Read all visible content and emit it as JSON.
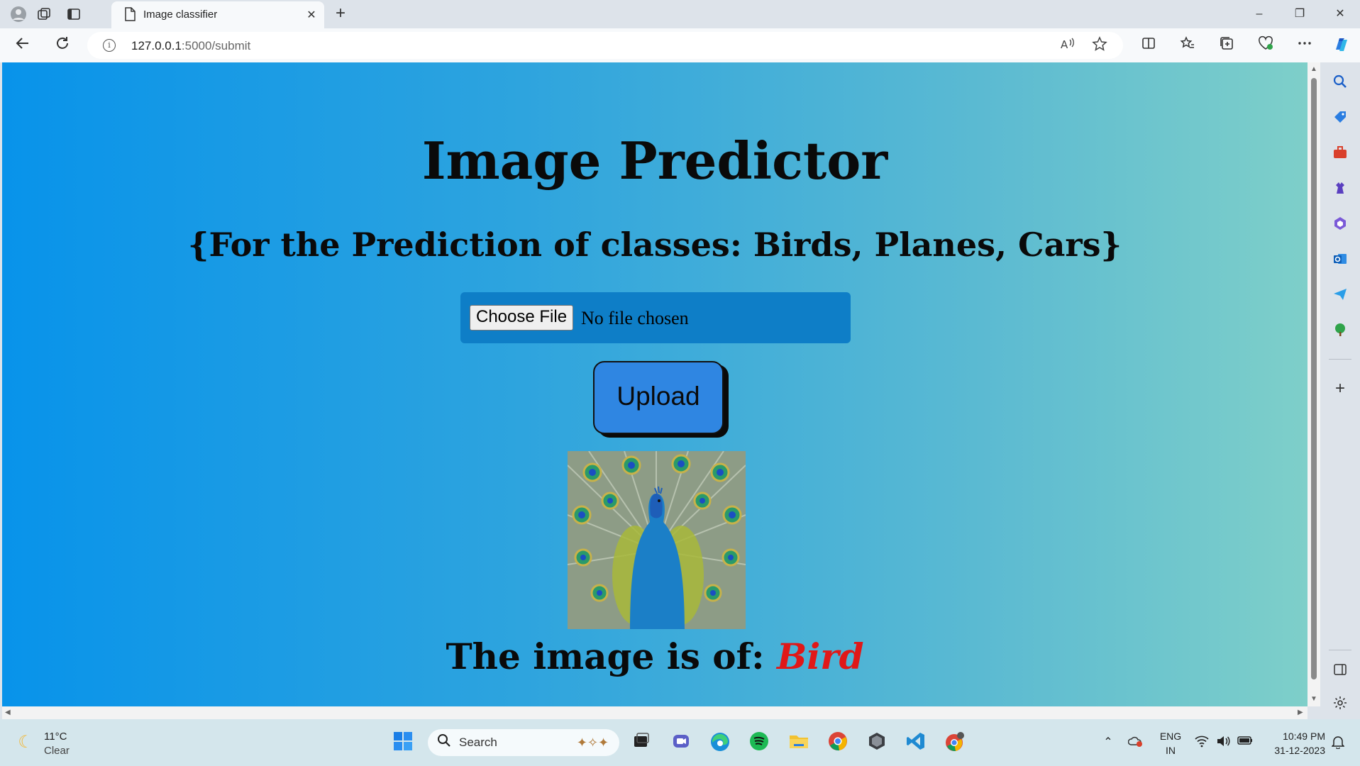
{
  "browser": {
    "tab_title": "Image classifier",
    "tab_close": "✕",
    "new_tab": "+",
    "url_host": "127.0.0.1",
    "url_path": ":5000/submit",
    "window_controls": {
      "minimize": "–",
      "restore": "❐",
      "close": "✕"
    }
  },
  "page": {
    "title": "Image Predictor",
    "subtitle": "{For the Prediction of classes: Birds, Planes, Cars}",
    "file_input": {
      "button_label": "Choose File",
      "status": "No file chosen"
    },
    "upload_label": "Upload",
    "preview_alt": "uploaded peacock image",
    "result_prefix": "The image is of: ",
    "result_class": "Bird",
    "colors": {
      "gradient_start": "#0893ea",
      "gradient_end": "#7ecfc9",
      "result_class": "#e01818",
      "upload_button": "#2f86e2"
    }
  },
  "taskbar": {
    "weather_temp": "11°C",
    "weather_condition": "Clear",
    "search_label": "Search",
    "language": "ENG",
    "region": "IN",
    "time": "10:49 PM",
    "date": "31-12-2023"
  },
  "icons": {
    "profile": "profile-icon",
    "workspaces": "workspaces-icon",
    "tab_actions": "tab-actions-icon",
    "page": "page-icon",
    "back": "back-icon",
    "refresh": "refresh-icon",
    "info": "info-icon",
    "read_aloud": "read-aloud-icon",
    "favorite": "star-icon",
    "split_screen": "split-screen-icon",
    "favorites": "favorites-icon",
    "collections": "collections-icon",
    "browser_essentials": "heart-pulse-icon",
    "more": "more-icon",
    "copilot": "copilot-icon",
    "weather": "moon-icon",
    "windows": "windows-start-icon"
  }
}
